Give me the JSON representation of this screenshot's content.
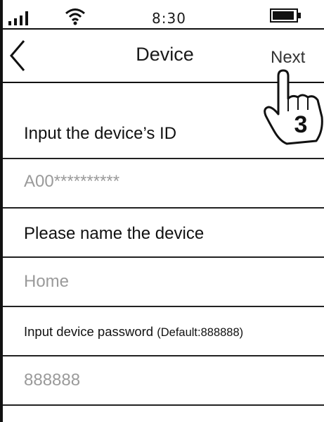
{
  "status_bar": {
    "time": "8:30",
    "icons": [
      "signal-icon",
      "wifi-icon",
      "battery-icon"
    ]
  },
  "nav": {
    "back_icon": "chevron-left-icon",
    "title": "Device",
    "next_label": "Next"
  },
  "form": {
    "device_id": {
      "label": "Input the device’s ID",
      "value": "A00**********"
    },
    "device_name": {
      "label": "Please name the device",
      "value": "Home"
    },
    "password": {
      "label": "Input device password",
      "hint": "(Default:888888)",
      "value": "888888"
    }
  },
  "step_badge": {
    "number": "3",
    "icon": "pointing-hand-icon"
  },
  "colors": {
    "border": "#111111",
    "placeholder": "#9a9a9a",
    "text": "#1a1a1a"
  }
}
